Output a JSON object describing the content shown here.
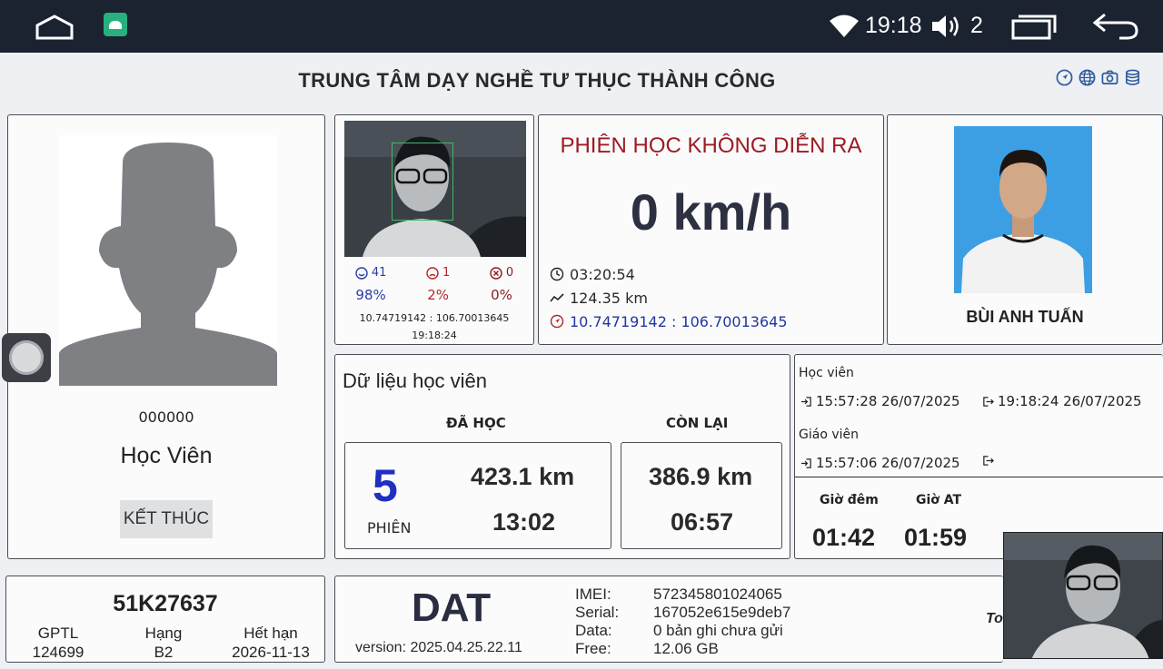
{
  "status_bar": {
    "time": "19:18",
    "volume_level": "2",
    "icons": [
      "home-icon",
      "android-app-icon",
      "wifi-icon",
      "volume-icon",
      "recent-apps-icon",
      "back-icon"
    ]
  },
  "header": {
    "title": "TRUNG TÂM DẠY NGHỀ TƯ THỤC THÀNH CÔNG",
    "icons": [
      "navigation-icon",
      "globe-icon",
      "camera-icon",
      "database-icon"
    ]
  },
  "student": {
    "id": "000000",
    "name": "Học Viên",
    "end_button": "KẾT THÚC"
  },
  "camera": {
    "stats": [
      {
        "count": "41",
        "percent": "98%",
        "icon": "smile-icon"
      },
      {
        "count": "1",
        "percent": "2%",
        "icon": "frown-icon"
      },
      {
        "count": "0",
        "percent": "0%",
        "icon": "cross-circle-icon"
      }
    ],
    "coordinates": "10.74719142 : 106.70013645",
    "time": "19:18:24"
  },
  "session": {
    "status": "PHIÊN HỌC KHÔNG DIỄN RA",
    "speed": "0 km/h",
    "duration": "03:20:54",
    "distance": "124.35 km",
    "gps": "10.74719142 : 106.70013645"
  },
  "teacher": {
    "name": "BÙI ANH TUẤN"
  },
  "training": {
    "title": "Dữ liệu học viên",
    "learned_header": "ĐÃ HỌC",
    "remaining_header": "CÒN LẠI",
    "sessions": "5",
    "sessions_label": "PHIÊN",
    "learned_km": "423.1 km",
    "learned_time": "13:02",
    "remaining_km": "386.9 km",
    "remaining_time": "06:57"
  },
  "log": {
    "student_label": "Học viên",
    "student_in": "15:57:28 26/07/2025",
    "student_out": "19:18:24 26/07/2025",
    "teacher_label": "Giáo viên",
    "teacher_in": "15:57:06 26/07/2025",
    "night_label": "Giờ đêm",
    "at_label": "Giờ AT",
    "night_value": "01:42",
    "at_value": "01:59"
  },
  "vehicle": {
    "plate": "51K27637",
    "license_label": "GPTL",
    "license_value": "124699",
    "class_label": "Hạng",
    "class_value": "B2",
    "expiry_label": "Hết hạn",
    "expiry_value": "2026-11-13"
  },
  "device": {
    "logo": "DAT",
    "version": "version: 2025.04.25.22.11",
    "imei_label": "IMEI:",
    "imei_value": "572345801024065",
    "serial_label": "Serial:",
    "serial_value": "167052e615e9deb7",
    "data_label": "Data:",
    "data_value": "0 bản ghi chưa gửi",
    "free_label": "Free:",
    "free_value": "12.06 GB",
    "partial_label": "To"
  },
  "colors": {
    "status_bar": "#1b2230",
    "session_status": "#9b1c22",
    "sessions_number": "#1e2fc2",
    "gps_text": "#2236a0"
  }
}
